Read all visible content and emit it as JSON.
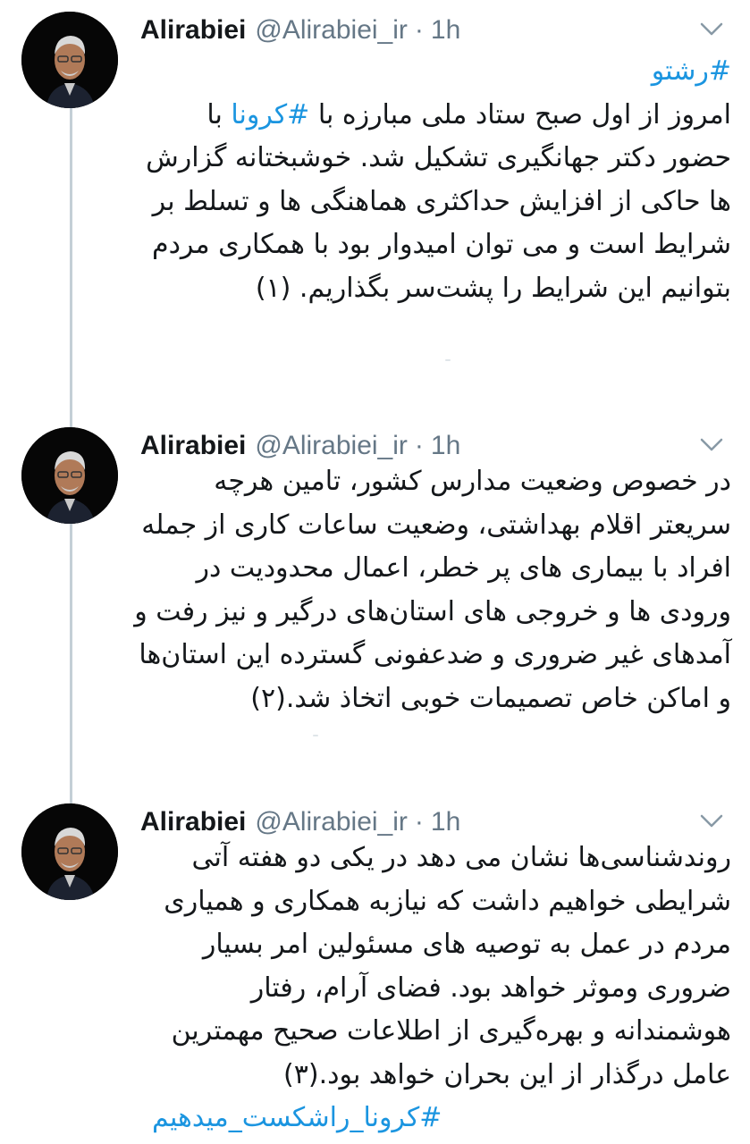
{
  "tweets": [
    {
      "author_name": "Alirabiei",
      "handle": "@Alirabiei_ir",
      "separator": "·",
      "time": "1h",
      "hashtag_top": "#رشتو",
      "line1_prefix": "امروز از اول صبح ستاد ملی مبارزه با ",
      "inline_hashtag": "#کرونا",
      "line1_suffix": " با",
      "text_rest": "حضور دکتر جهانگیری تشکیل شد. خوشبختانه گزارش ها حاکی از افزایش حداکثری هماهنگی ها و تسلط بر شرایط است و می توان امیدوار بود با همکاری مردم بتوانیم این شرایط را پشت‌سر بگذاریم. (۱)"
    },
    {
      "author_name": "Alirabiei",
      "handle": "@Alirabiei_ir",
      "separator": "·",
      "time": "1h",
      "text": "در خصوص وضعیت مدارس کشور، تامین هرچه سریعتر اقلام بهداشتی، وضعیت ساعات کاری از جمله افراد با بیماری های پر خطر، اعمال محدودیت در ورودی ها و خروجی های استان‌های درگیر و نیز رفت و آمدهای غیر ضروری و ضدعفونی گسترده این استان‌ها و اماکن خاص تصمیمات خوبی اتخاذ شد.(۲)"
    },
    {
      "author_name": "Alirabiei",
      "handle": "@Alirabiei_ir",
      "separator": "·",
      "time": "1h",
      "text": "روندشناسی‌ها نشان می دهد در یکی دو هفته آتی شرایطی خواهیم داشت که نیازبه همکاری و همیاری مردم در عمل به توصیه های مسئولین امر بسیار ضروری وموثر خواهد بود. فضای آرام، رفتار هوشمندانه و بهره‌گیری از اطلاعات صحیح مهمترین عامل درگذار از این بحران خواهد بود.(۳)",
      "hashtag_bottom": "#کرونا_راشکست_میدهیم"
    }
  ],
  "colors": {
    "link": "#1b95e0",
    "secondary_text": "#657786",
    "thread_line": "#c4cfd6",
    "avatar_background": "#060606"
  },
  "icons": {
    "avatar": "profile-photo",
    "menu": "chevron-down-icon"
  }
}
